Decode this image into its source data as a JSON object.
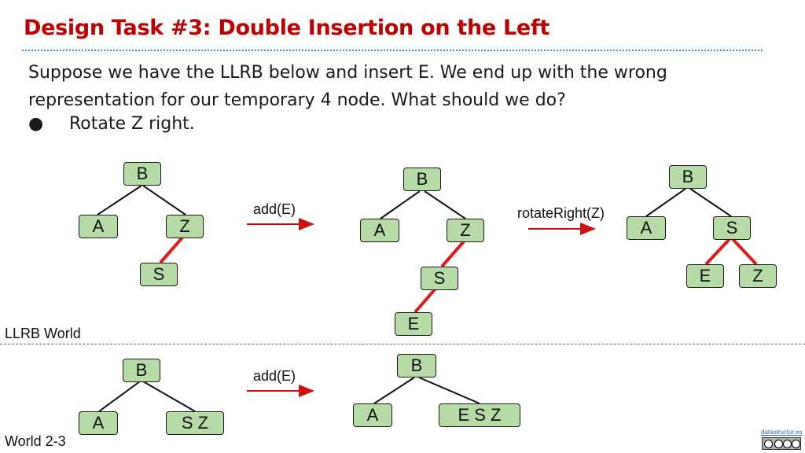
{
  "slide": {
    "title": "Design Task #3: Double Insertion on the Left",
    "paragraph": "Suppose we have the LLRB below and insert E. We end up with the wrong representation for our temporary 4 node. What should we do?",
    "bullet_symbol": "●",
    "bullet": "Rotate Z right."
  },
  "llrb": {
    "world_label": "LLRB World",
    "op1": "add(E)",
    "op2": "rotateRight(Z)",
    "tree1": {
      "root": "B",
      "left": "A",
      "right": "Z",
      "red_child": "S"
    },
    "tree2": {
      "root": "B",
      "left": "A",
      "right": "Z",
      "red_child": "S",
      "red_grandchild": "E"
    },
    "tree3": {
      "root": "B",
      "left": "A",
      "right": "S",
      "red_left": "E",
      "red_right": "Z"
    }
  },
  "world23": {
    "world_label": "World 2-3",
    "op": "add(E)",
    "tree1": {
      "root": "B",
      "left": "A",
      "right": "S Z"
    },
    "tree2": {
      "root": "B",
      "left": "A",
      "right": "E S Z"
    }
  },
  "footer": {
    "brand": "datastructur.es",
    "license_icon": "cc-by-nc-sa-icon"
  },
  "colors": {
    "title": "#c00000",
    "node_fill": "#b7dba6",
    "red_link": "#e01b1b",
    "arrow": "#cc1111"
  }
}
